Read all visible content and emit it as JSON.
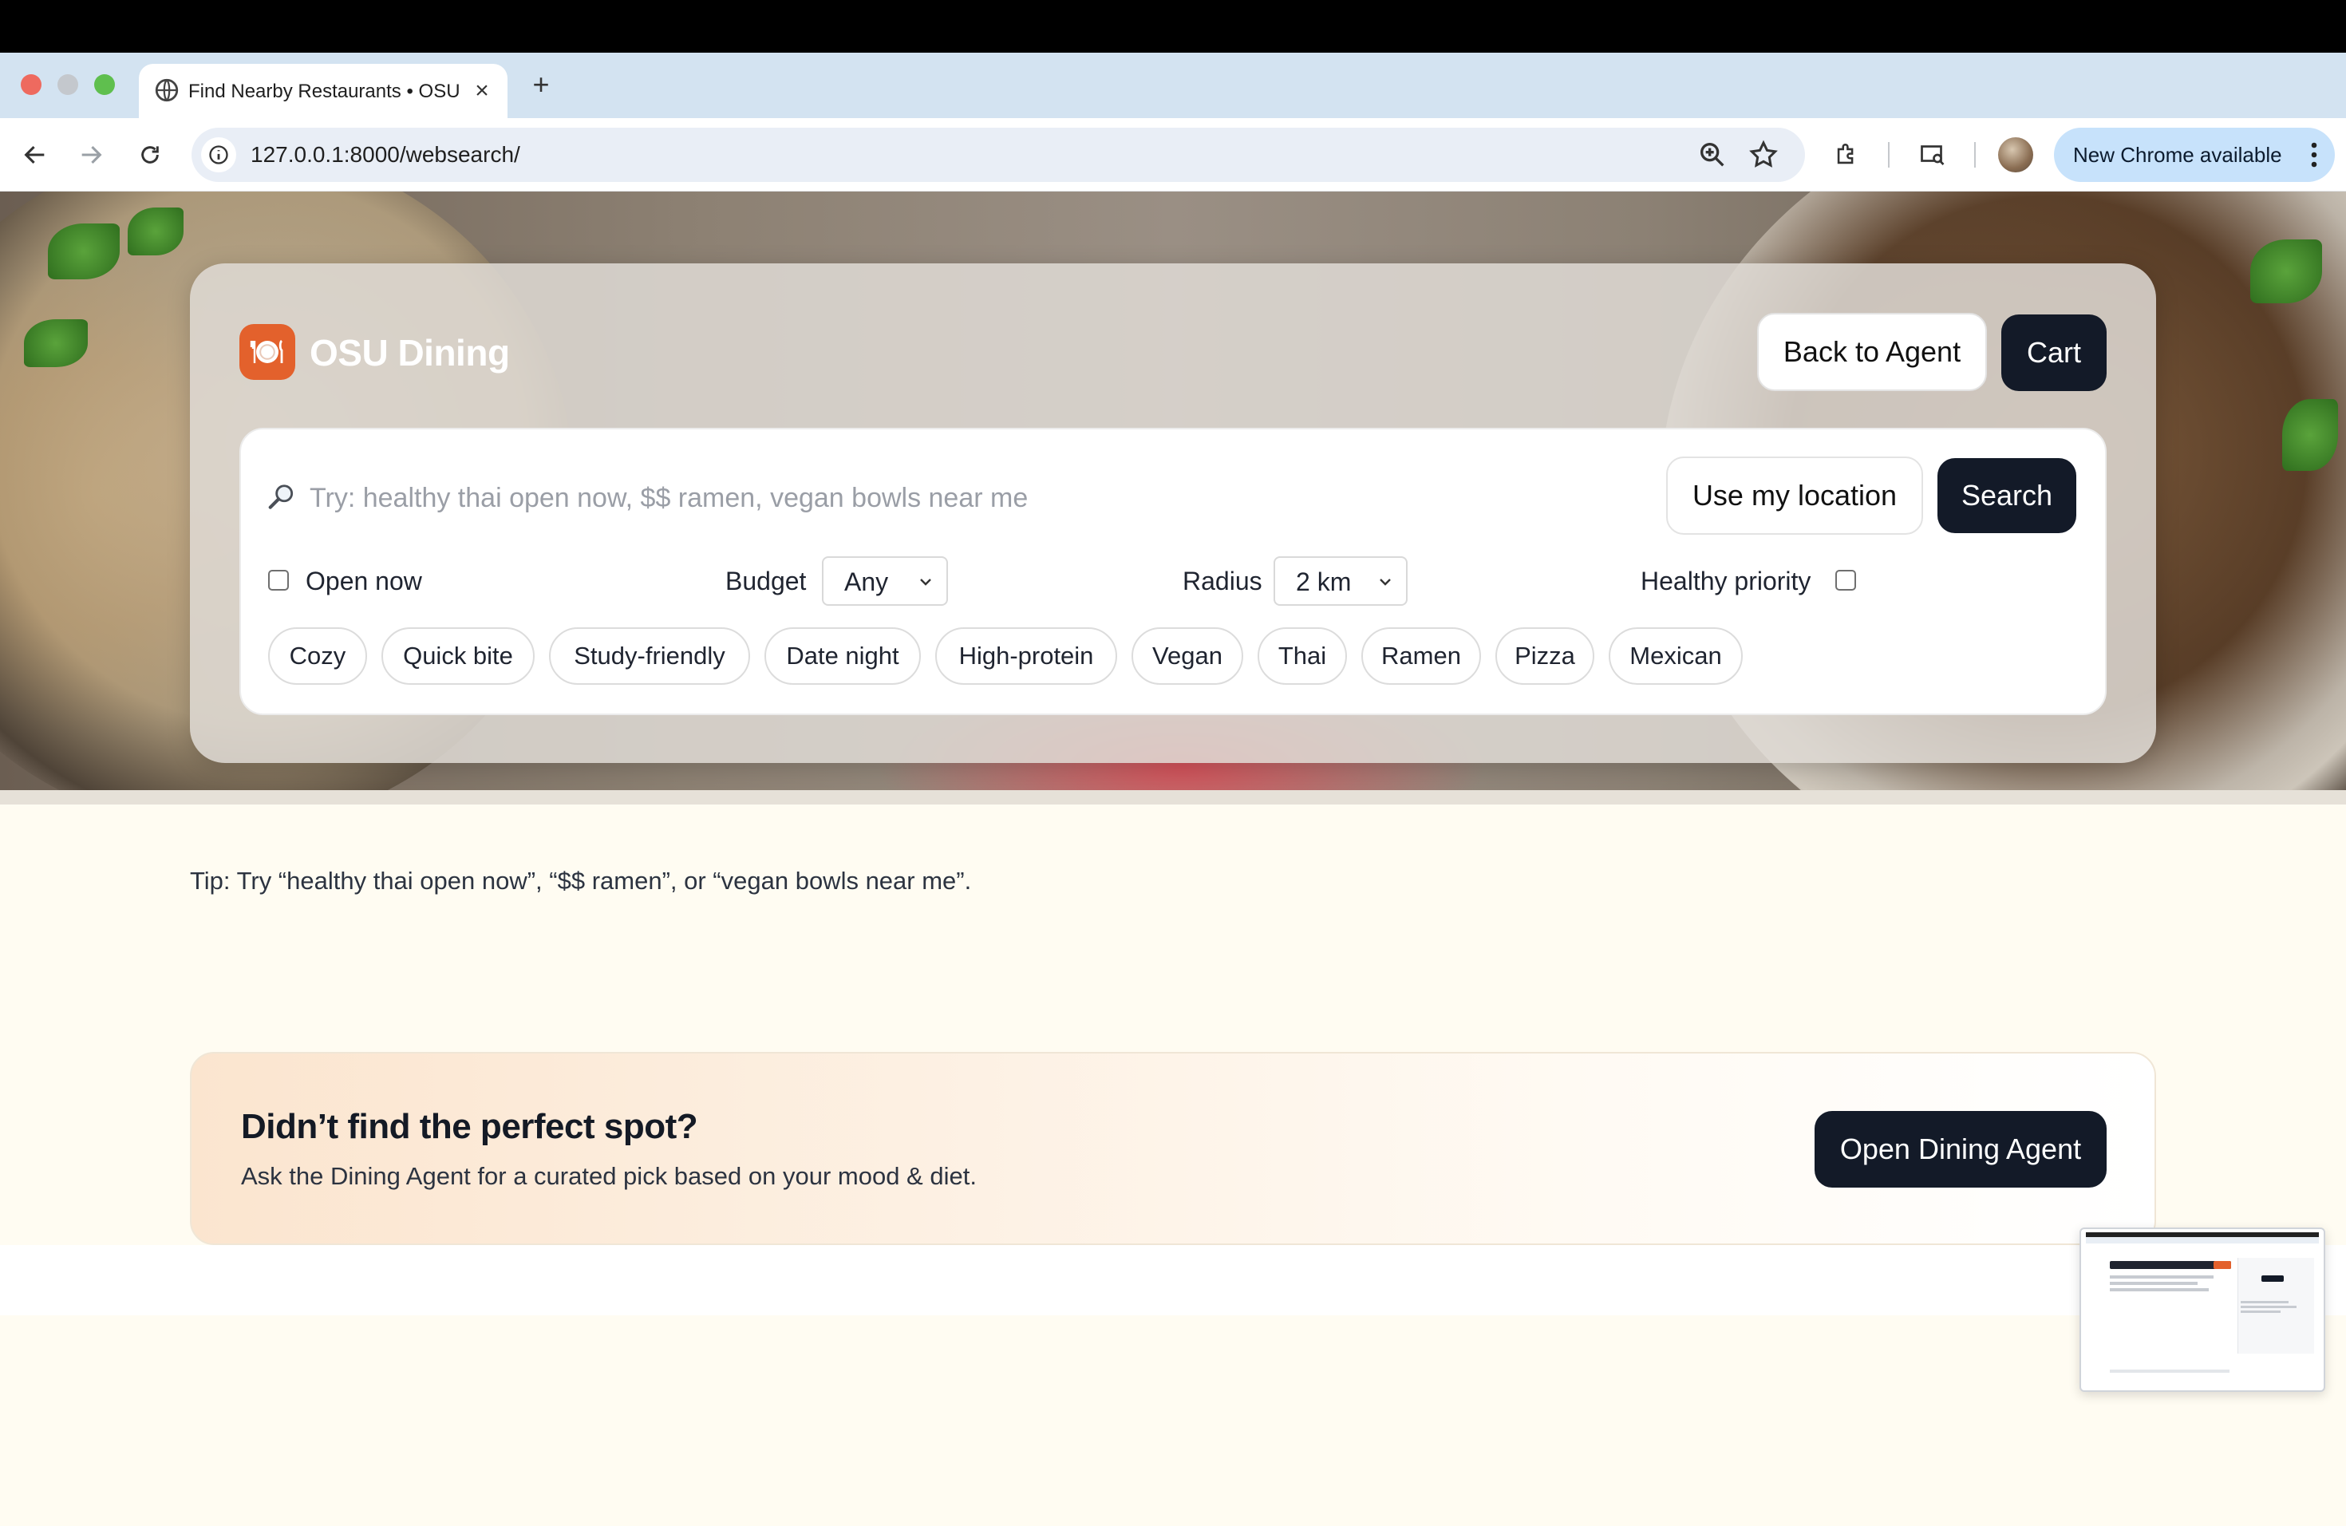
{
  "browser": {
    "tab_title": "Find Nearby Restaurants • OSU Dining",
    "url": "127.0.0.1:8000/websearch/",
    "update_label": "New Chrome available",
    "icons": [
      "back-arrow-icon",
      "forward-arrow-icon",
      "reload-icon",
      "site-info-icon",
      "zoom-icon",
      "star-icon",
      "extensions-icon",
      "media-icon",
      "more-icon"
    ]
  },
  "header": {
    "brand_name": "OSU Dining",
    "back_to_agent": "Back to Agent",
    "cart": "Cart"
  },
  "search": {
    "placeholder": "Try: healthy thai open now, $$ ramen, vegan bowls near me",
    "use_location": "Use my location",
    "search_button": "Search"
  },
  "filters": {
    "open_now_label": "Open now",
    "open_now_checked": false,
    "budget_label": "Budget",
    "budget_value": "Any",
    "radius_label": "Radius",
    "radius_value": "2 km",
    "healthy_label": "Healthy priority",
    "healthy_checked": false
  },
  "chips": [
    "Cozy",
    "Quick bite",
    "Study-friendly",
    "Date night",
    "High-protein",
    "Vegan",
    "Thai",
    "Ramen",
    "Pizza",
    "Mexican"
  ],
  "tip": "Tip: Try “healthy thai open now”, “$$ ramen”, or “vegan bowls near me”.",
  "cta": {
    "title": "Didn’t find the perfect spot?",
    "subtitle": "Ask the Dining Agent for a curated pick based on your mood & diet.",
    "button": "Open Dining Agent"
  },
  "colors": {
    "brand_orange": "#e3612c",
    "dark_button": "#131a28",
    "page_bg": "#fffcf2"
  }
}
